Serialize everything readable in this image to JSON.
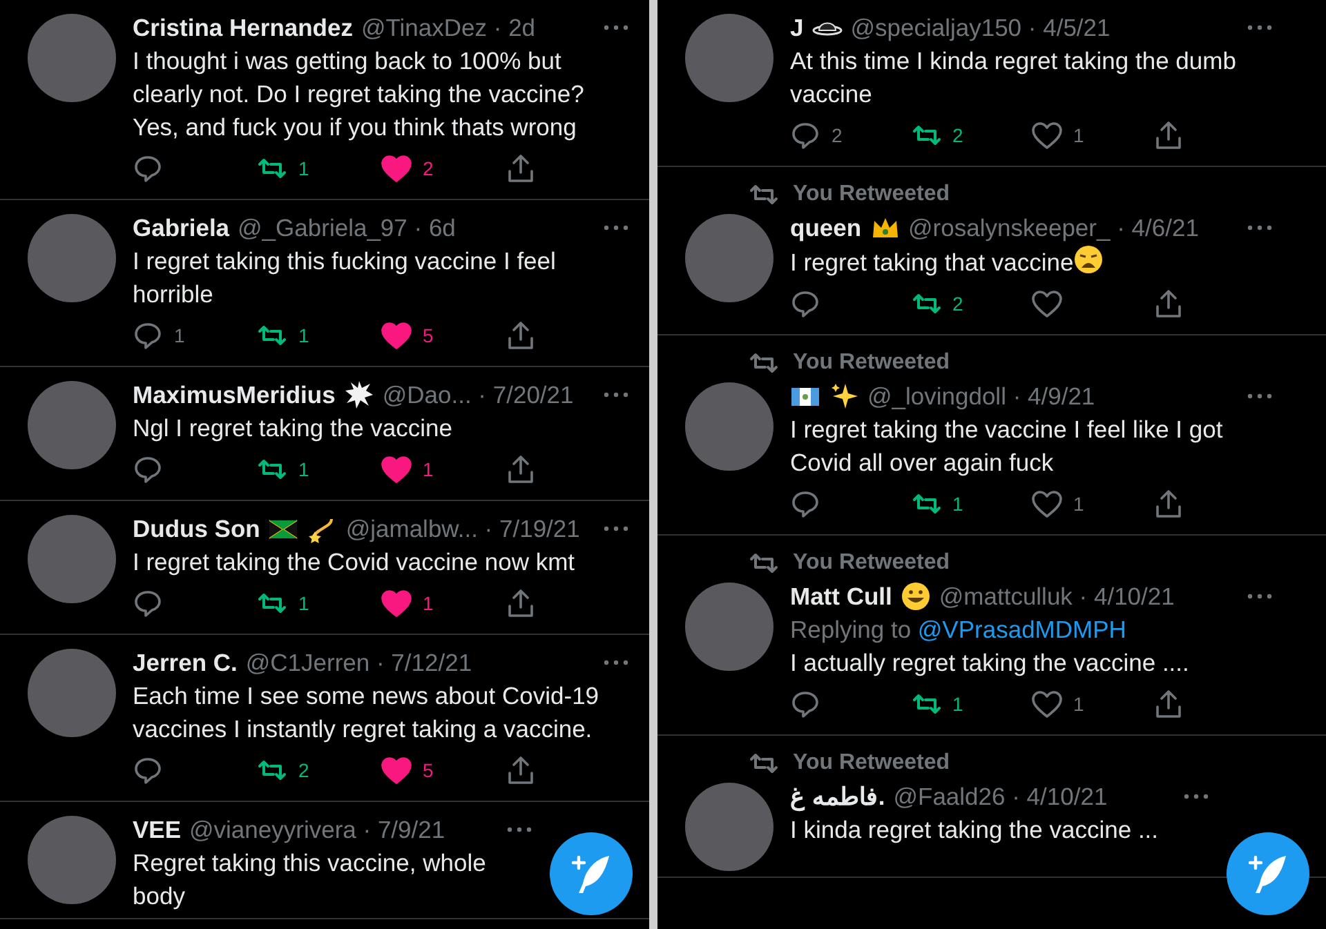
{
  "panels": [
    {
      "tweets": [
        {
          "name": "Cristina Hernandez",
          "meta": "@TinaxDez · 2d",
          "text": "I thought i was getting back to 100% but clearly not. Do I regret taking the vaccine? Yes, and fuck you if you think thats wrong",
          "actions": {
            "retweets": "1",
            "likes": "2",
            "retweeted": true,
            "liked": true
          }
        },
        {
          "name": "Gabriela",
          "meta": "@_Gabriela_97 · 6d",
          "text": "I regret taking this fucking vaccine I feel horrible",
          "actions": {
            "reply": "1",
            "retweets": "1",
            "likes": "5",
            "retweeted": true,
            "liked": true
          }
        },
        {
          "name": "MaximusMeridius",
          "badges": [
            {
              "kind": "burst"
            }
          ],
          "meta": "@Dao... · 7/20/21",
          "text": "Ngl I regret taking the vaccine",
          "actions": {
            "retweets": "1",
            "likes": "1",
            "retweeted": true,
            "liked": true
          }
        },
        {
          "name": "Dudus Son",
          "badges": [
            {
              "kind": "flag-cross"
            },
            {
              "kind": "dizzy"
            }
          ],
          "meta": "@jamalbw... · 7/19/21",
          "text": "I regret taking the Covid vaccine now kmt",
          "actions": {
            "retweets": "1",
            "likes": "1",
            "retweeted": true,
            "liked": true
          }
        },
        {
          "name": "Jerren C.",
          "meta": "@C1Jerren · 7/12/21",
          "text": "Each time I see some news about Covid-19 vaccines I instantly regret taking a vaccine.",
          "actions": {
            "retweets": "2",
            "likes": "5",
            "retweeted": true,
            "liked": true
          }
        },
        {
          "name": "VEE",
          "meta": "@vianeyyrivera · 7/9/21",
          "text": "Regret taking this vaccine, whole body"
        }
      ]
    },
    {
      "tweets": [
        {
          "name": "J",
          "badges": [
            {
              "kind": "hat"
            }
          ],
          "meta": "@specialjay150 · 4/5/21",
          "text": "At this time I kinda regret taking the dumb vaccine",
          "actions": {
            "reply": "2",
            "retweets": "2",
            "likes": "1",
            "retweeted": true,
            "liked": false
          }
        },
        {
          "context": "You Retweeted",
          "name": "queen",
          "badges": [
            {
              "kind": "crown"
            }
          ],
          "meta": "@rosalynskeeper_ · 4/6/21",
          "text": "I regret taking that vaccine",
          "text_emoji": {
            "kind": "weary"
          },
          "actions": {
            "retweets": "2",
            "retweeted": true,
            "liked": false
          }
        },
        {
          "context": "You Retweeted",
          "badges": [
            {
              "kind": "flag-stripes"
            },
            {
              "kind": "sparkles"
            }
          ],
          "meta": "@_lovingdoll · 4/9/21",
          "text": "I regret taking the vaccine I feel like I got Covid all over again fuck",
          "actions": {
            "retweets": "1",
            "likes": "1",
            "retweeted": true,
            "liked": false
          }
        },
        {
          "context": "You Retweeted",
          "name": "Matt Cull",
          "badges": [
            {
              "kind": "grin"
            }
          ],
          "meta": "@mattculluk · 4/10/21",
          "replying": "Replying to",
          "replying_to": "@VPrasadMDMPH",
          "text": "I actually regret taking the vaccine ....",
          "actions": {
            "retweets": "1",
            "likes": "1",
            "retweeted": true,
            "liked": false
          }
        },
        {
          "context": "You Retweeted",
          "name": "فاطمه غ.",
          "meta": "@Faald26 · 4/10/21",
          "text": "I kinda regret taking the vaccine ..."
        }
      ]
    }
  ]
}
